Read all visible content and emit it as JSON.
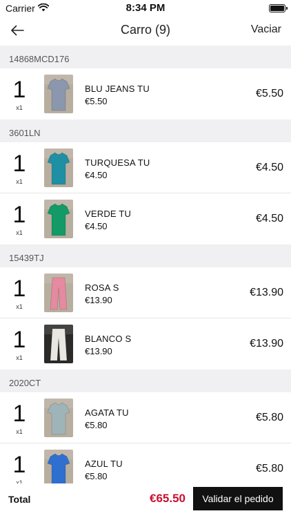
{
  "status_bar": {
    "carrier": "Carrier",
    "time": "8:34 PM"
  },
  "nav": {
    "title": "Carro (9)",
    "clear_label": "Vaciar"
  },
  "sections": [
    {
      "header": "14868MCD176",
      "items": [
        {
          "qty": "1",
          "qty_note": "x1",
          "name": "BLU JEANS TU",
          "price": "€5.50",
          "line_total": "€5.50",
          "color": "#8a97ad"
        }
      ]
    },
    {
      "header": "3601LN",
      "items": [
        {
          "qty": "1",
          "qty_note": "x1",
          "name": "TURQUESA TU",
          "price": "€4.50",
          "line_total": "€4.50",
          "color": "#1f8fa3"
        },
        {
          "qty": "1",
          "qty_note": "x1",
          "name": "VERDE TU",
          "price": "€4.50",
          "line_total": "€4.50",
          "color": "#139a66"
        }
      ]
    },
    {
      "header": "15439TJ",
      "items": [
        {
          "qty": "1",
          "qty_note": "x1",
          "name": "ROSA S",
          "price": "€13.90",
          "line_total": "€13.90",
          "color": "#e58aa0"
        },
        {
          "qty": "1",
          "qty_note": "x1",
          "name": "BLANCO S",
          "price": "€13.90",
          "line_total": "€13.90",
          "color": "#e9e7e2"
        }
      ]
    },
    {
      "header": "2020CT",
      "items": [
        {
          "qty": "1",
          "qty_note": "x1",
          "name": "AGATA TU",
          "price": "€5.80",
          "line_total": "€5.80",
          "color": "#9fb4b8"
        },
        {
          "qty": "1",
          "qty_note": "x1",
          "name": "AZUL TU",
          "price": "€5.80",
          "line_total": "€5.80",
          "color": "#2f6fd0"
        }
      ]
    }
  ],
  "footer": {
    "total_label": "Total",
    "total_value": "€65.50",
    "validate_label": "Validar el pedido"
  },
  "colors": {
    "accent_total": "#c8102e",
    "button_bg": "#111111",
    "section_bg": "#f0f0f2"
  },
  "icons": {
    "back": "arrow-left-icon",
    "wifi": "wifi-icon",
    "battery": "battery-icon"
  }
}
